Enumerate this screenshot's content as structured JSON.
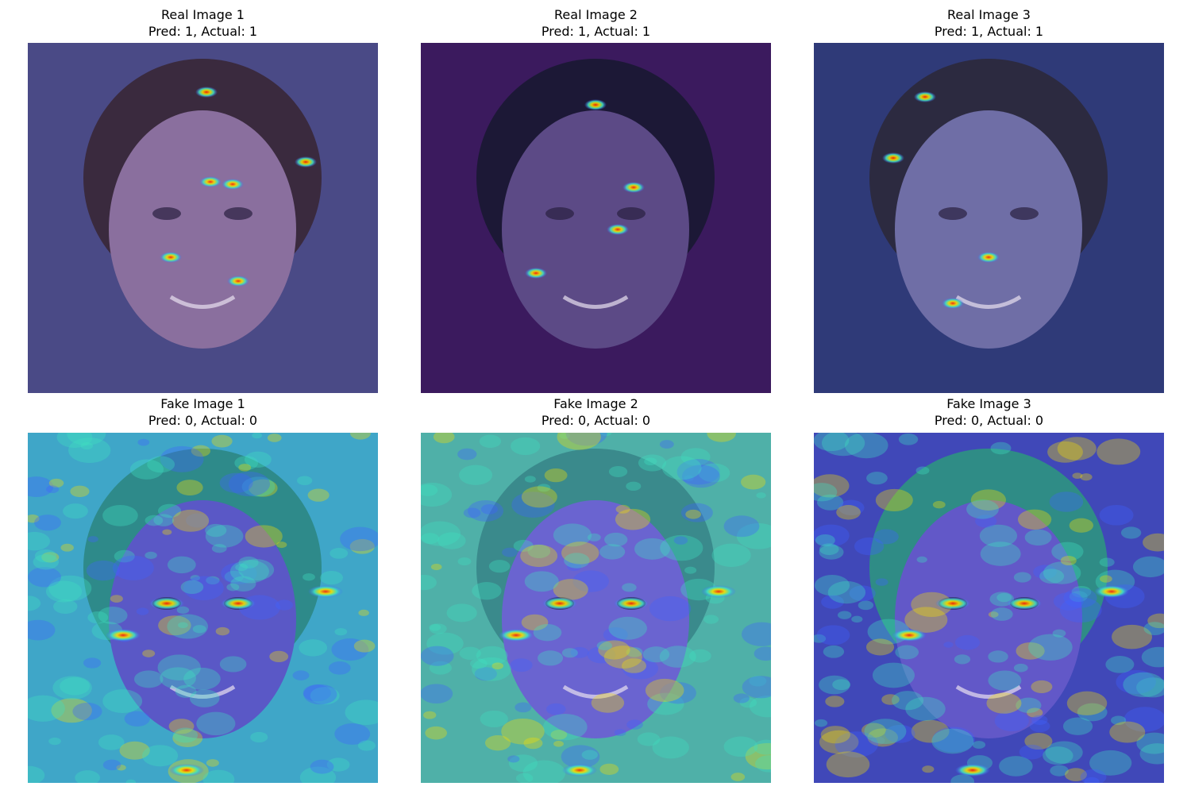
{
  "figure": {
    "rows": [
      {
        "panels": [
          {
            "line1": "Real Image 1",
            "line2": "Pred: 1, Actual: 1",
            "kind": "real",
            "bg": "#4a4a86",
            "face": "#8a6f9e",
            "hair": "#3a2a3e"
          },
          {
            "line1": "Real Image 2",
            "line2": "Pred: 1, Actual: 1",
            "kind": "real",
            "bg": "#3b1a5e",
            "face": "#5c4a86",
            "hair": "#1c1836"
          },
          {
            "line1": "Real Image 3",
            "line2": "Pred: 1, Actual: 1",
            "kind": "real",
            "bg": "#2f3a78",
            "face": "#6f6ea6",
            "hair": "#2c2a40"
          }
        ]
      },
      {
        "panels": [
          {
            "line1": "Fake Image 1",
            "line2": "Pred: 0, Actual: 0",
            "kind": "fake",
            "bg": "#3fa6c8",
            "face": "#5a58c6",
            "hair": "#2e8a8a"
          },
          {
            "line1": "Fake Image 2",
            "line2": "Pred: 0, Actual: 0",
            "kind": "fake",
            "bg": "#4fb0a8",
            "face": "#6a64d0",
            "hair": "#3a8a8c"
          },
          {
            "line1": "Fake Image 3",
            "line2": "Pred: 0, Actual: 0",
            "kind": "fake",
            "bg": "#4048b8",
            "face": "#6258c8",
            "hair": "#2f8c86"
          }
        ]
      }
    ],
    "heatmap_colors": {
      "hot": "#ff2200",
      "warm": "#f5e000",
      "mid": "#40e0c0",
      "cool": "#4060ff"
    }
  }
}
